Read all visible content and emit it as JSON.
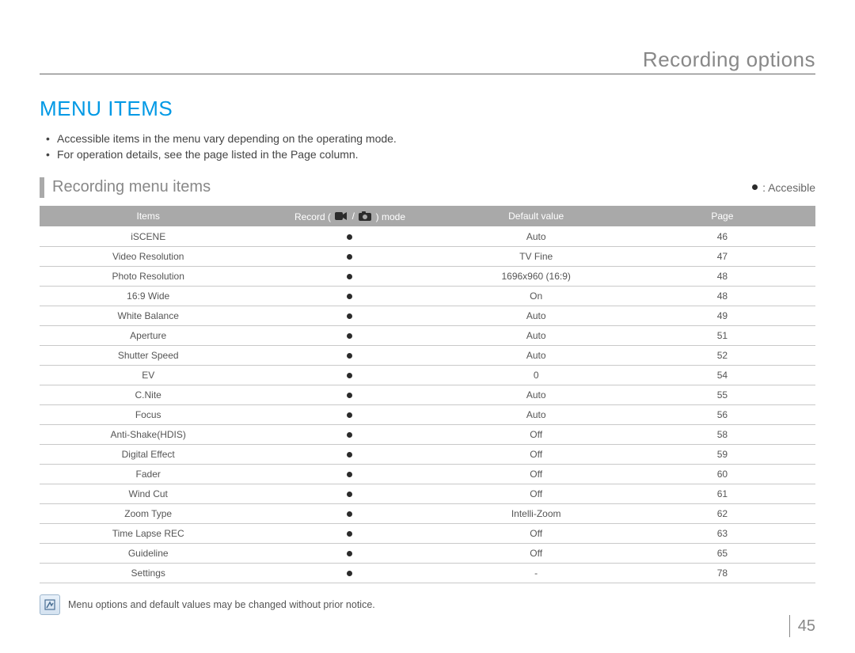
{
  "header": {
    "section_title": "Recording options"
  },
  "h1": "Menu Items",
  "bullets": [
    "Accessible items in the menu vary depending on the operating mode.",
    "For operation details, see the page listed in the Page column."
  ],
  "subhead": "Recording menu items",
  "legend_label": ": Accesible",
  "table": {
    "col_items": "Items",
    "col_mode_pre": "Record (",
    "col_mode_post": ") mode",
    "col_default": "Default value",
    "col_page": "Page",
    "rows": [
      {
        "item": "iSCENE",
        "default": "Auto",
        "page": "46"
      },
      {
        "item": "Video Resolution",
        "default": "TV Fine",
        "page": "47"
      },
      {
        "item": "Photo Resolution",
        "default": "1696x960 (16:9)",
        "page": "48"
      },
      {
        "item": "16:9 Wide",
        "default": "On",
        "page": "48"
      },
      {
        "item": "White Balance",
        "default": "Auto",
        "page": "49"
      },
      {
        "item": "Aperture",
        "default": "Auto",
        "page": "51"
      },
      {
        "item": "Shutter Speed",
        "default": "Auto",
        "page": "52"
      },
      {
        "item": "EV",
        "default": "0",
        "page": "54"
      },
      {
        "item": "C.Nite",
        "default": "Auto",
        "page": "55"
      },
      {
        "item": "Focus",
        "default": "Auto",
        "page": "56"
      },
      {
        "item": "Anti-Shake(HDIS)",
        "default": "Off",
        "page": "58"
      },
      {
        "item": "Digital Effect",
        "default": "Off",
        "page": "59"
      },
      {
        "item": "Fader",
        "default": "Off",
        "page": "60"
      },
      {
        "item": "Wind Cut",
        "default": "Off",
        "page": "61"
      },
      {
        "item": "Zoom Type",
        "default": "Intelli-Zoom",
        "page": "62"
      },
      {
        "item": "Time Lapse REC",
        "default": "Off",
        "page": "63"
      },
      {
        "item": "Guideline",
        "default": "Off",
        "page": "65"
      },
      {
        "item": "Settings",
        "default": "-",
        "page": "78"
      }
    ]
  },
  "note": "Menu options and default values may be changed without prior notice.",
  "page_number": "45"
}
